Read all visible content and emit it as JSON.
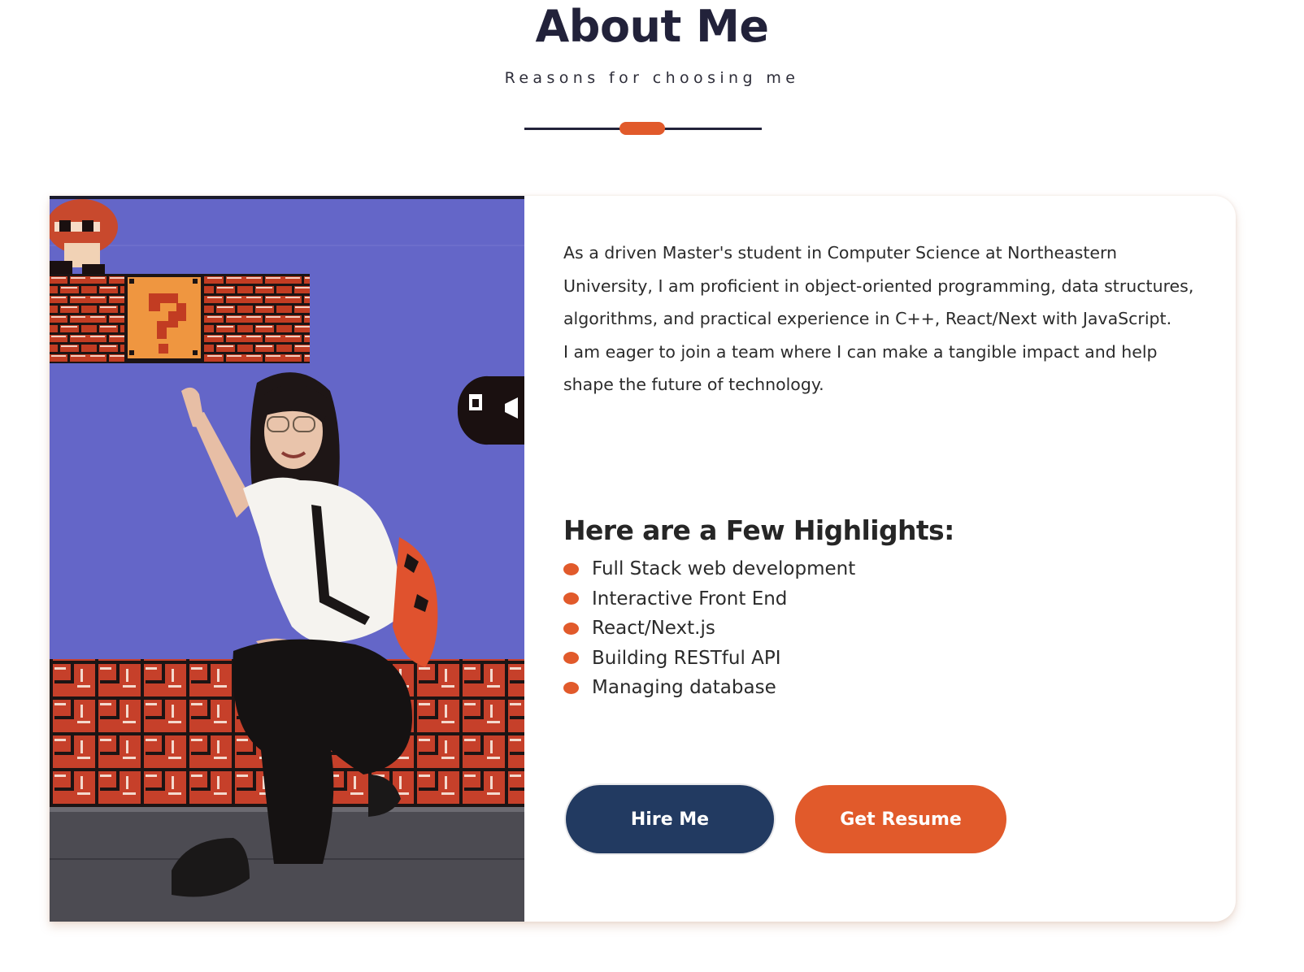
{
  "header": {
    "title": "About Me",
    "subtitle": "Reasons for choosing me"
  },
  "colors": {
    "accent": "#e15a2b",
    "navy": "#223a61",
    "heading": "#22223a"
  },
  "about": {
    "intro_paragraphs": [
      "As a driven Master's student in Computer Science at Northeastern University, I am proficient in object-oriented programming, data structures, algorithms, and practical experience in C++, React/Next with JavaScript.",
      "I am eager to join a team where I can make a tangible impact and help shape the future of technology."
    ],
    "photo_icon": "profile-photo"
  },
  "highlights": {
    "title": "Here are a Few Highlights:",
    "items": [
      "Full Stack web development",
      "Interactive Front End",
      "React/Next.js",
      "Building RESTful API",
      "Managing database"
    ]
  },
  "actions": {
    "hire_label": "Hire Me",
    "resume_label": "Get Resume"
  }
}
